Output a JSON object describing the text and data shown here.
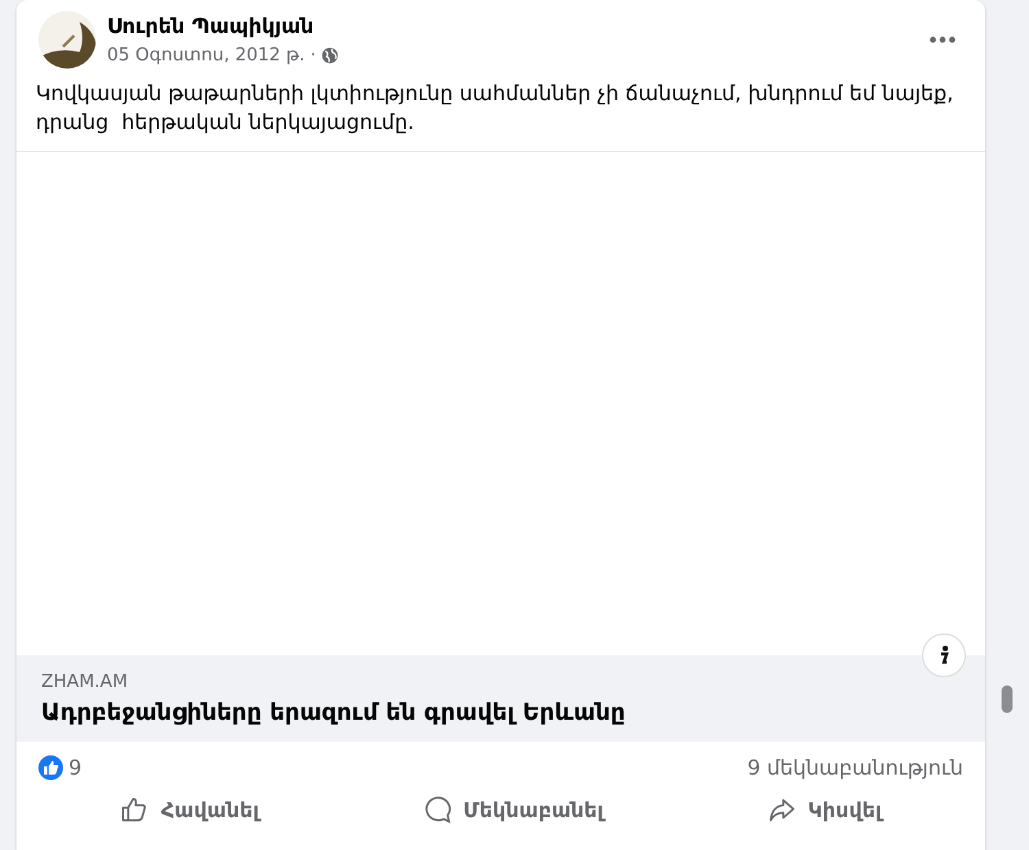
{
  "post": {
    "author": "Սուրեն Պապիկյան",
    "date": "05 Օգոստոս, 2012 թ.",
    "separator": "·",
    "text": "Կովկասյան թաթարների լկտիությունը սահմաններ չի ճանաչում, խնդրում եմ նայեք, դրանց  հերթական ներկայացումը."
  },
  "link": {
    "domain": "ZHAM.AM",
    "title": "Ադրբեջանցիները երազում են գրավել Երևանը"
  },
  "reactions": {
    "likes": "9",
    "comments": "9 մեկնաբանություն"
  },
  "actions": [
    {
      "kind": "like",
      "label": "Հավանել"
    },
    {
      "kind": "comment",
      "label": "Մեկնաբանել"
    },
    {
      "kind": "share",
      "label": "Կիսվել"
    }
  ]
}
